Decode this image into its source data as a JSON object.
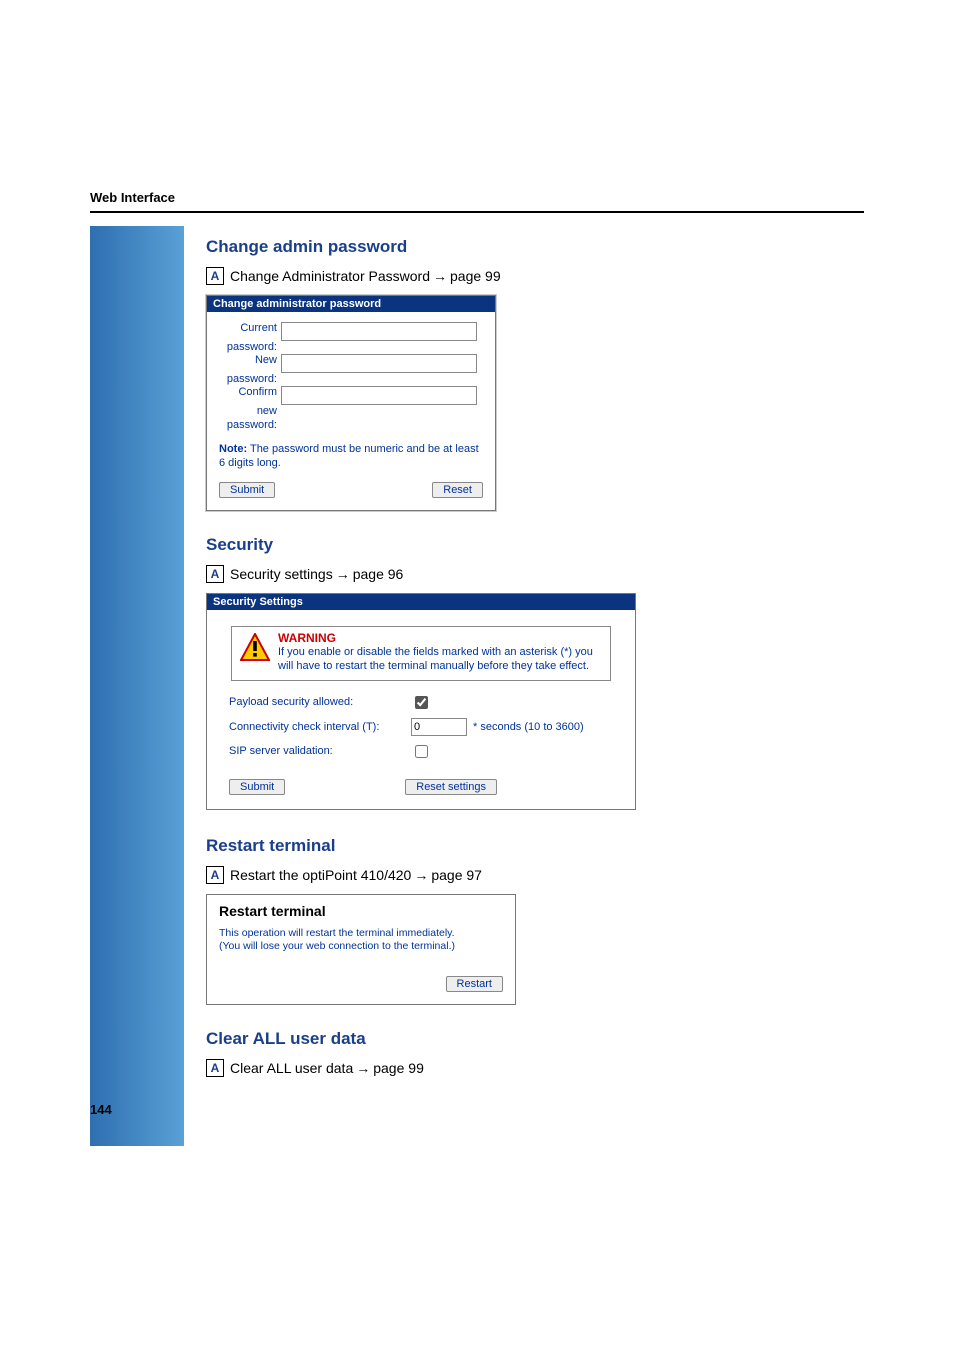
{
  "header": {
    "title": "Web Interface"
  },
  "sections": {
    "change_password": {
      "heading": "Change admin password",
      "ref_text": "Change Administrator Password",
      "ref_page_prefix": "page",
      "ref_page": "99",
      "panel_title": "Change administrator password",
      "labels": {
        "current_l1": "Current",
        "current_l2": "password:",
        "new_l1": "New",
        "new_l2": "password:",
        "confirm_l1": "Confirm",
        "confirm_l2": "new",
        "confirm_l3": "password:"
      },
      "note_bold": "Note:",
      "note_text": "The password must be numeric and be at least 6 digits long.",
      "submit": "Submit",
      "reset": "Reset"
    },
    "security": {
      "heading": "Security",
      "ref_text": "Security settings",
      "ref_page_prefix": "page",
      "ref_page": "96",
      "panel_title": "Security Settings",
      "warn_title": "WARNING",
      "warn_text": "If you enable or disable the fields marked with an asterisk (*) you will have to restart the terminal manually before they take effect.",
      "row_payload": "Payload security allowed:",
      "row_conn": "Connectivity check interval (T):",
      "conn_value": "0",
      "conn_suffix": "* seconds (10 to 3600)",
      "row_sip": "SIP server validation:",
      "submit": "Submit",
      "reset": "Reset settings"
    },
    "restart": {
      "heading": "Restart terminal",
      "ref_text": "Restart the optiPoint 410/420",
      "ref_page_prefix": "page",
      "ref_page": "97",
      "panel_heading": "Restart terminal",
      "line1": "This operation will restart the terminal immediately.",
      "line2": "(You will lose your web connection to the terminal.)",
      "button": "Restart"
    },
    "clear": {
      "heading": "Clear ALL user data",
      "ref_text": "Clear ALL user data",
      "ref_page_prefix": "page",
      "ref_page": "99"
    }
  },
  "a_box_label": "A",
  "page_number": "144"
}
